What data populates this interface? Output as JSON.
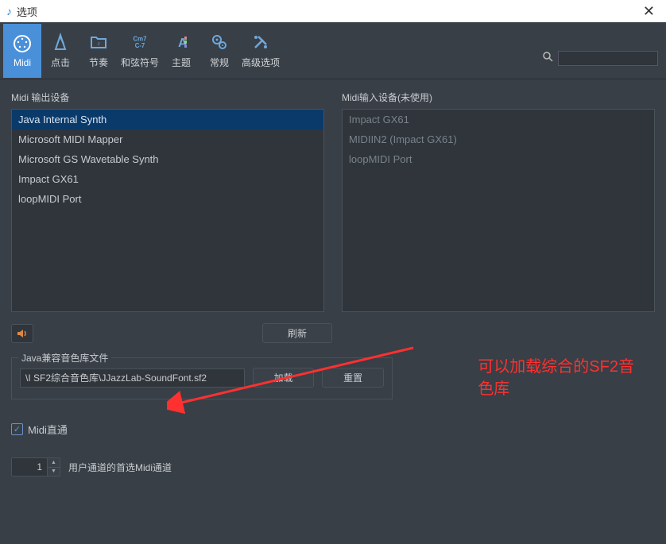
{
  "window": {
    "title": "选项"
  },
  "toolbar": {
    "items": [
      {
        "label": "Midi"
      },
      {
        "label": "点击"
      },
      {
        "label": "节奏"
      },
      {
        "label": "和弦符号"
      },
      {
        "label": "主题"
      },
      {
        "label": "常规"
      },
      {
        "label": "高级选项"
      }
    ]
  },
  "labels": {
    "midi_out": "Midi 输出设备",
    "midi_in": "Midi输入设备(未使用)",
    "refresh": "刷新",
    "soundbank_section": "Java兼容音色库文件",
    "load": "加载",
    "reset": "重置",
    "midi_thru": "Midi直通",
    "preferred_channel": "用户通道的首选Midi通道"
  },
  "midi_out_devices": [
    "Java Internal Synth",
    "Microsoft MIDI Mapper",
    "Microsoft GS Wavetable Synth",
    "Impact GX61",
    "loopMIDI Port"
  ],
  "midi_in_devices": [
    "Impact GX61",
    "MIDIIN2 (Impact GX61)",
    "loopMIDI Port"
  ],
  "soundbank_path": "\\I SF2综合音色库\\JJazzLab-SoundFont.sf2",
  "channel_value": "1",
  "annotation": {
    "line1": "可以加载综合的SF2音",
    "line2": "色库"
  }
}
